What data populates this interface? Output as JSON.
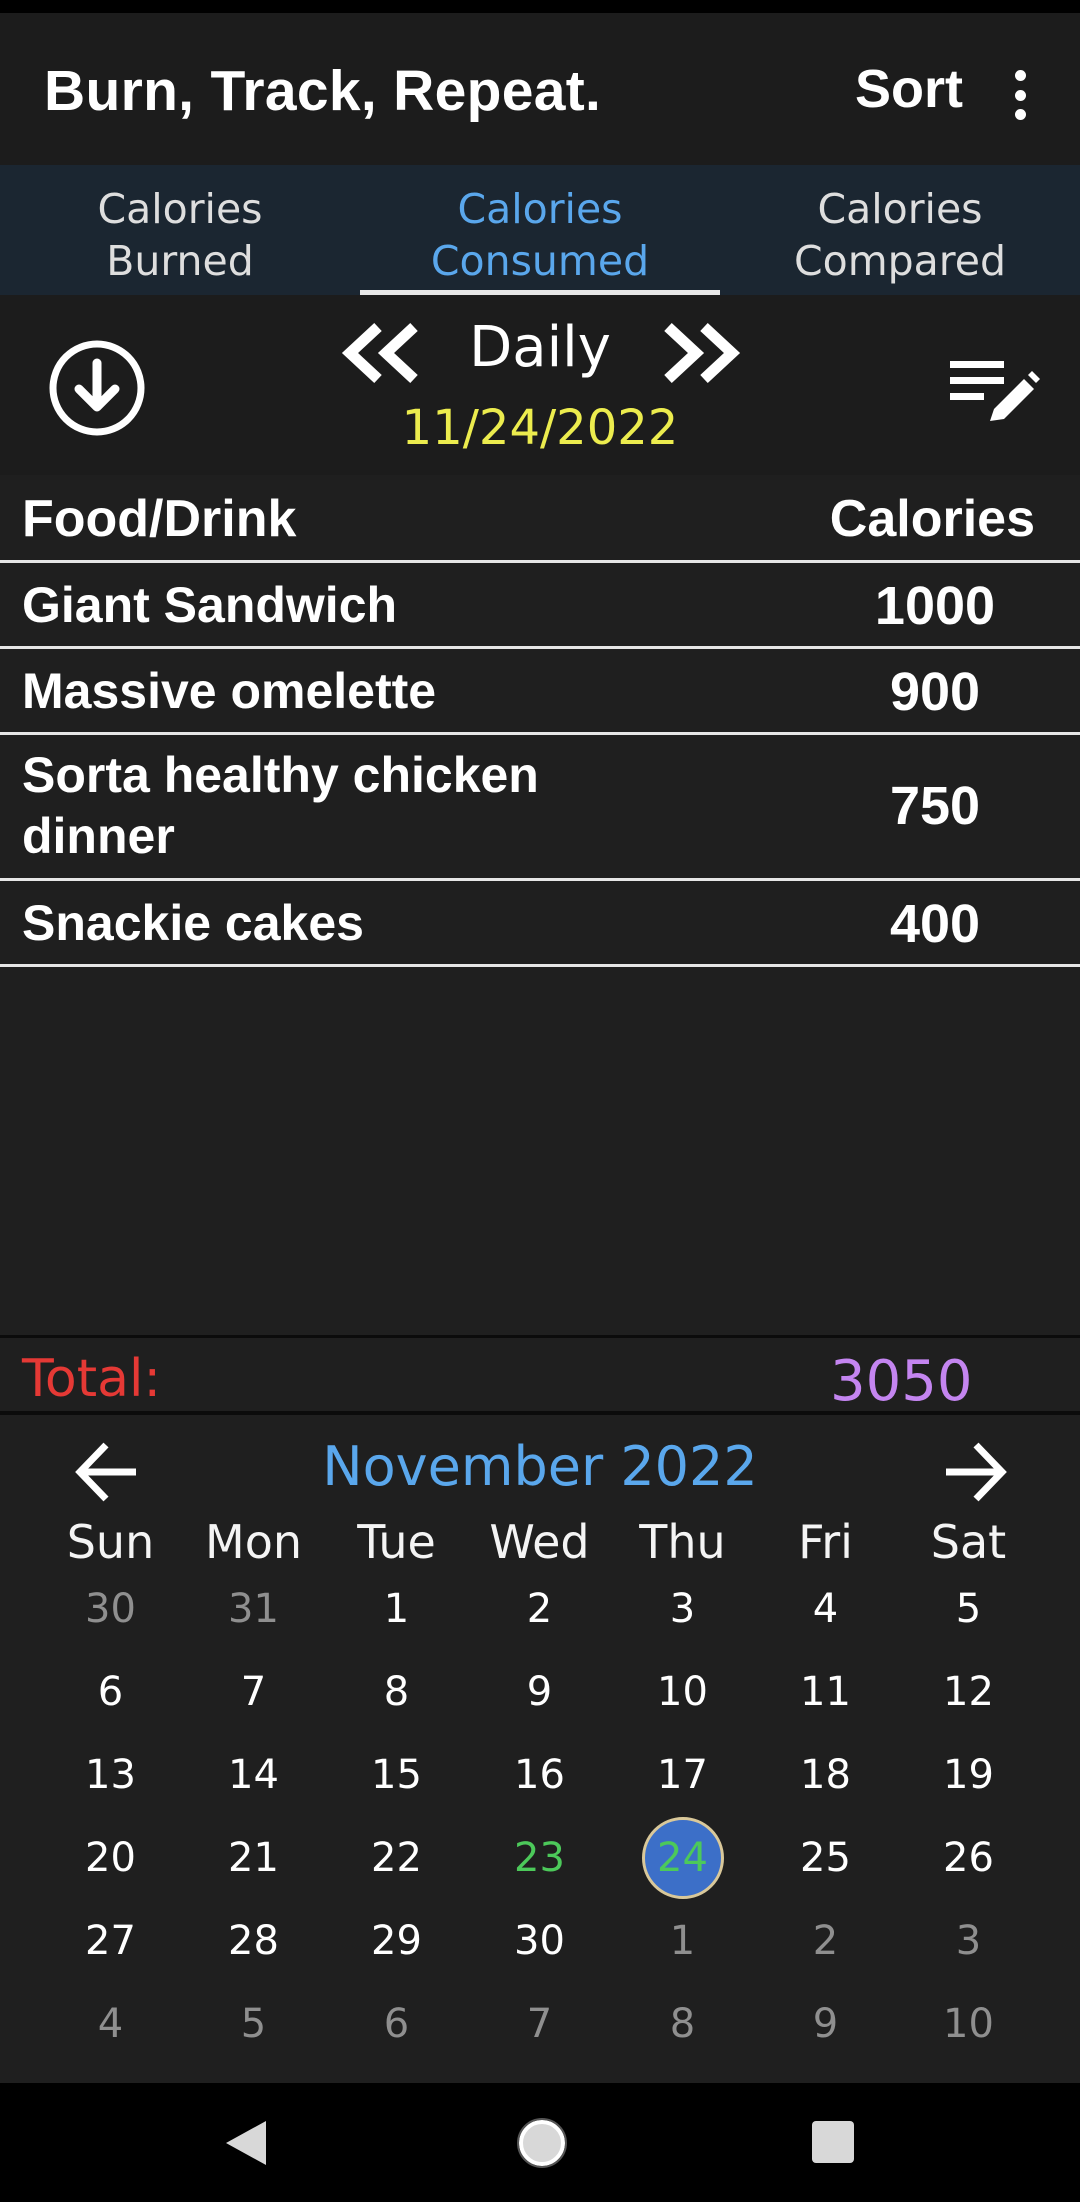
{
  "app": {
    "title": "Burn, Track, Repeat.",
    "sort_label": "Sort",
    "overflow_icon": "more-vert-icon"
  },
  "tabs": [
    {
      "label_line1": "Calories",
      "label_line2": "Burned",
      "active": false
    },
    {
      "label_line1": "Calories",
      "label_line2": "Consumed",
      "active": true
    },
    {
      "label_line1": "Calories",
      "label_line2": "Compared",
      "active": false
    }
  ],
  "controls": {
    "download_icon": "download-circle-icon",
    "prev_icon": "double-chevron-left-icon",
    "next_icon": "double-chevron-right-icon",
    "period": "Daily",
    "date": "11/24/2022",
    "edit_icon": "edit-list-icon"
  },
  "table": {
    "headers": {
      "food": "Food/Drink",
      "calories": "Calories"
    },
    "rows": [
      {
        "food": "Giant Sandwich",
        "calories": "1000"
      },
      {
        "food": "Massive omelette",
        "calories": "900"
      },
      {
        "food": "Sorta healthy chicken dinner",
        "calories": "750"
      },
      {
        "food": "Snackie cakes",
        "calories": "400"
      }
    ]
  },
  "total": {
    "label": "Total:",
    "value": "3050"
  },
  "calendar": {
    "month_label": "November 2022",
    "weekdays": [
      "Sun",
      "Mon",
      "Tue",
      "Wed",
      "Thu",
      "Fri",
      "Sat"
    ],
    "weeks": [
      [
        "30",
        "31",
        "1",
        "2",
        "3",
        "4",
        "5"
      ],
      [
        "6",
        "7",
        "8",
        "9",
        "10",
        "11",
        "12"
      ],
      [
        "13",
        "14",
        "15",
        "16",
        "17",
        "18",
        "19"
      ],
      [
        "20",
        "21",
        "22",
        "23",
        "24",
        "25",
        "26"
      ],
      [
        "27",
        "28",
        "29",
        "30",
        "1",
        "2",
        "3"
      ],
      [
        "4",
        "5",
        "6",
        "7",
        "8",
        "9",
        "10"
      ]
    ],
    "selected_day": "24",
    "today_day": "23"
  },
  "colors": {
    "accent_blue": "#5aa7ec",
    "date_yellow": "#ecec4e",
    "total_red": "#e53935",
    "total_purple": "#c485f0",
    "today_green": "#4cc95a",
    "selected_fill": "#3c6fc8"
  }
}
